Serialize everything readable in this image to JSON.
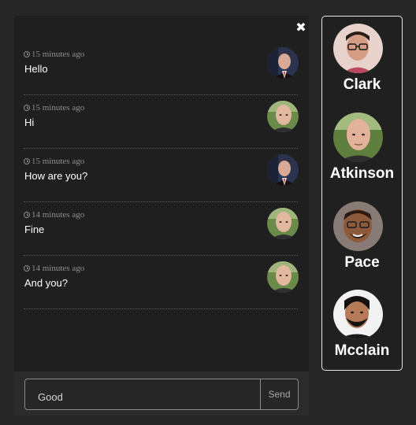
{
  "chat": {
    "close_glyph": "✖",
    "messages": [
      {
        "time": "15 minutes ago",
        "text": "Hello",
        "avatar": "clark-avatar"
      },
      {
        "time": "15 minutes ago",
        "text": "Hi",
        "avatar": "atkinson-avatar"
      },
      {
        "time": "15 minutes ago",
        "text": "How are you?",
        "avatar": "clark-avatar"
      },
      {
        "time": "14 minutes ago",
        "text": "Fine",
        "avatar": "atkinson-avatar"
      },
      {
        "time": "14 minutes ago",
        "text": "And you?",
        "avatar": "atkinson-avatar"
      }
    ]
  },
  "composer": {
    "input_value": "Good",
    "send_label": "Send"
  },
  "contacts": [
    {
      "name": "Clark"
    },
    {
      "name": "Atkinson"
    },
    {
      "name": "Pace"
    },
    {
      "name": "Mcclain"
    }
  ]
}
